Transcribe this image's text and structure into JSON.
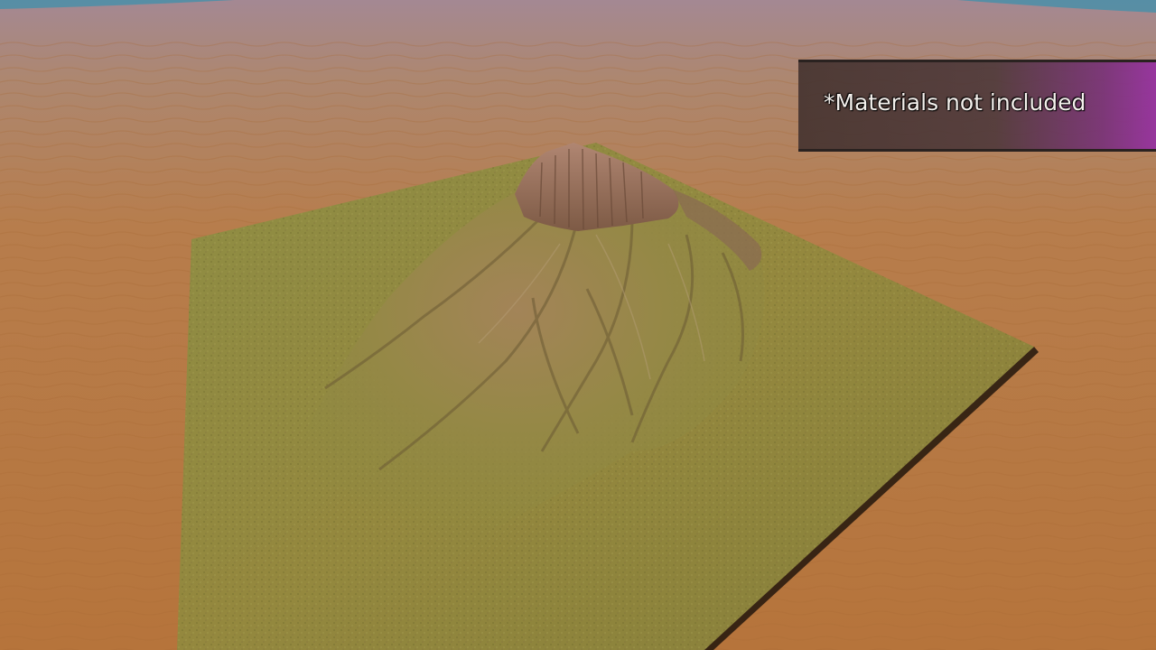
{
  "scene": {
    "caption": "*Materials not included",
    "colors": {
      "sand": "#b8793f",
      "sky_haze": "#a58a90",
      "water": "#4a8fa8",
      "grass": "#8c8a3a",
      "rock": "#9a6e55",
      "shadow": "#2a1c10",
      "banner_dark": "#463430",
      "banner_purple": "#9632a0"
    }
  }
}
